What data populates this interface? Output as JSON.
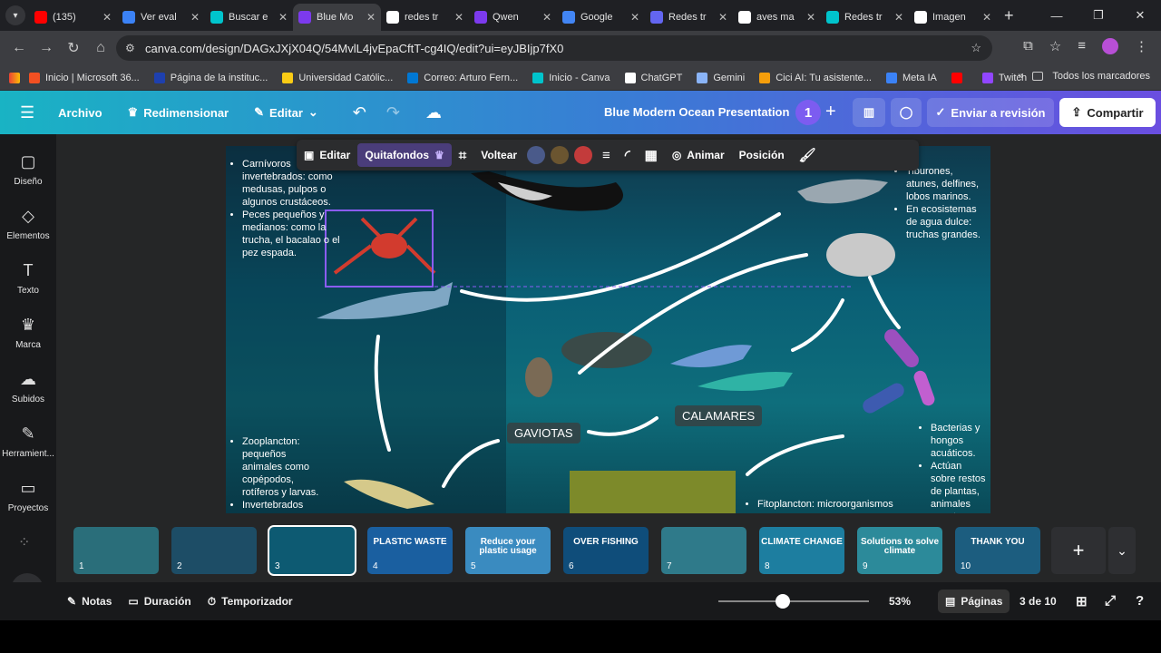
{
  "browser": {
    "tabs": [
      {
        "title": "(135)",
        "color": "#ff0000"
      },
      {
        "title": "Ver eval",
        "color": "#3b82f6"
      },
      {
        "title": "Buscar e",
        "color": "#00c4cc"
      },
      {
        "title": "Blue Mo",
        "color": "#7c3aed"
      },
      {
        "title": "redes tr",
        "color": "#ffffff"
      },
      {
        "title": "Qwen",
        "color": "#7c3aed"
      },
      {
        "title": "Google",
        "color": "#4285f4"
      },
      {
        "title": "Redes tr",
        "color": "#6366f1"
      },
      {
        "title": "aves ma",
        "color": "#ffffff"
      },
      {
        "title": "Redes tr",
        "color": "#00c4cc"
      },
      {
        "title": "Imagen",
        "color": "#ffffff"
      }
    ],
    "url": "canva.com/design/DAGxJXjX04Q/54MvlL4jvEpaCftT-cg4IQ/edit?ui=eyJBIjp7fX0",
    "bookmarks": [
      {
        "label": "Inicio | Microsoft 36...",
        "color": "#f25022"
      },
      {
        "label": "Página de la instituc...",
        "color": "#1e40af"
      },
      {
        "label": "Universidad Católic...",
        "color": "#facc15"
      },
      {
        "label": "Correo: Arturo Fern...",
        "color": "#0078d4"
      },
      {
        "label": "Inicio - Canva",
        "color": "#00c4cc"
      },
      {
        "label": "ChatGPT",
        "color": "#ffffff"
      },
      {
        "label": "Gemini",
        "color": "#8ab4f8"
      },
      {
        "label": "Cici AI: Tu asistente...",
        "color": "#f59e0b"
      },
      {
        "label": "Meta IA",
        "color": "#3b82f6"
      },
      {
        "label": "",
        "color": "#ff0000"
      },
      {
        "label": "Twitch",
        "color": "#9146ff"
      }
    ],
    "all_bookmarks": "Todos los marcadores"
  },
  "canva": {
    "menu": [
      "Archivo",
      "Redimensionar",
      "Editar"
    ],
    "doc_title": "Blue Modern Ocean Presentation",
    "collaborators": "1",
    "review": "Enviar a revisión",
    "share": "Compartir"
  },
  "sidebar": [
    {
      "label": "Diseño",
      "icon": "layout-icon"
    },
    {
      "label": "Elementos",
      "icon": "shapes-icon"
    },
    {
      "label": "Texto",
      "icon": "text-icon"
    },
    {
      "label": "Marca",
      "icon": "brand-icon"
    },
    {
      "label": "Subidos",
      "icon": "upload-icon"
    },
    {
      "label": "Herramient...",
      "icon": "tools-icon"
    },
    {
      "label": "Proyectos",
      "icon": "folder-icon"
    }
  ],
  "float_toolbar": {
    "edit": "Editar",
    "bg_remover": "Quitafondos",
    "flip": "Voltear",
    "animate": "Animar",
    "position": "Posición",
    "colors": [
      "#4a5a8a",
      "#6b5530",
      "#c33b3b"
    ]
  },
  "slide": {
    "text_top_left": [
      "Carnívoros invertebrados: como medusas, pulpos o algunos crustáceos.",
      "Peces pequeños y medianos: como la trucha, el bacalao o el pez espada."
    ],
    "text_top_right": [
      "Tiburones, atunes, delfines, lobos marinos.",
      "En ecosistemas de agua dulce: truchas grandes."
    ],
    "text_bottom_left": [
      "Zooplancton: pequeños animales como copépodos, rotíferos y larvas.",
      "Invertebrados"
    ],
    "text_bottom_right": [
      "Bacterias y hongos acuáticos.",
      "Actúan sobre restos de plantas, animales muertos y"
    ],
    "text_bottom_mid": "Fitoplancton: microorganismos",
    "label_gaviotas": "GAVIOTAS",
    "label_calamares": "CALAMARES"
  },
  "pages": [
    {
      "n": "1",
      "title": "",
      "bg": "#2a6e7a"
    },
    {
      "n": "2",
      "title": "",
      "bg": "#1d4d66"
    },
    {
      "n": "3",
      "title": "",
      "bg": "#0d5a72"
    },
    {
      "n": "4",
      "title": "PLASTIC WASTE",
      "bg": "#1a5fa0"
    },
    {
      "n": "5",
      "title": "Reduce your plastic usage",
      "bg": "#3a8bc0"
    },
    {
      "n": "6",
      "title": "OVER FISHING",
      "bg": "#0f4d7a"
    },
    {
      "n": "7",
      "title": "",
      "bg": "#2f7a8a"
    },
    {
      "n": "8",
      "title": "CLIMATE CHANGE",
      "bg": "#1d7ea0"
    },
    {
      "n": "9",
      "title": "Solutions to solve climate",
      "bg": "#2c8a9a"
    },
    {
      "n": "10",
      "title": "THANK YOU",
      "bg": "#1c5d7f"
    }
  ],
  "footer": {
    "notes": "Notas",
    "duration": "Duración",
    "timer": "Temporizador",
    "zoom": "53%",
    "zoom_level": 0.43,
    "pages_btn": "Páginas",
    "page_counter": "3 de 10"
  }
}
